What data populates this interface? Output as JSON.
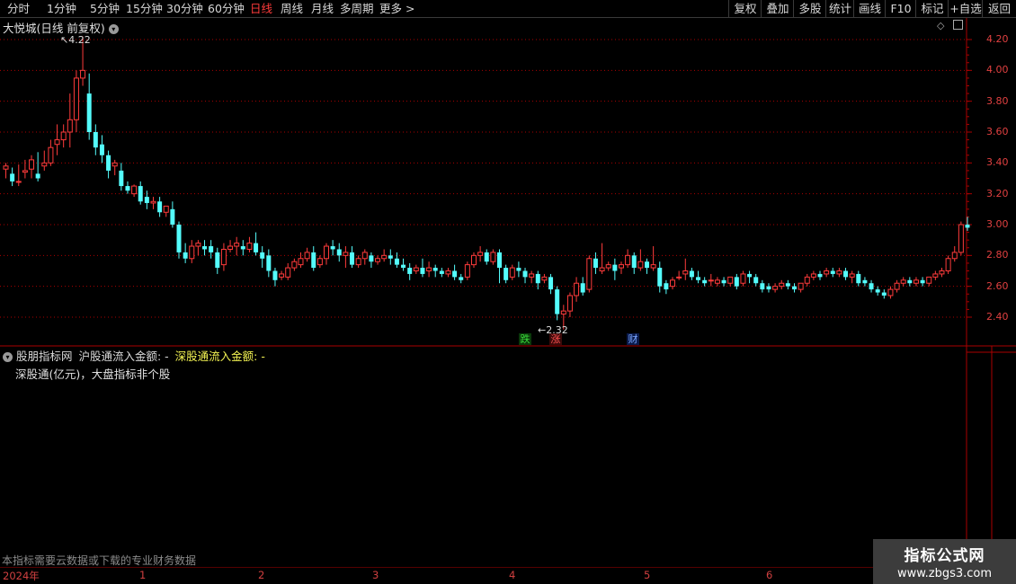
{
  "toolbar": {
    "periods": [
      "分时",
      "1分钟",
      "5分钟",
      "15分钟",
      "30分钟",
      "60分钟",
      "日线",
      "周线",
      "月线",
      "多周期",
      "更多 >"
    ],
    "active_period": "日线",
    "actions": [
      "复权",
      "叠加",
      "多股",
      "统计",
      "画线",
      "F10",
      "标记",
      "+自选",
      "返回"
    ]
  },
  "chart_title": "大悦城(日线 前复权)",
  "price_axis": [
    "4.20",
    "4.00",
    "3.80",
    "3.60",
    "3.40",
    "3.20",
    "3.00",
    "2.80",
    "2.60",
    "2.40"
  ],
  "annotations": {
    "high": "4.22",
    "low": "2.32"
  },
  "event_marks": [
    {
      "text": "跌",
      "color": "#3ad83a"
    },
    {
      "text": "涨",
      "color": "#ff4040"
    },
    {
      "text": "财",
      "color": "#5a8cff"
    }
  ],
  "indicator": {
    "source": "股朋指标网",
    "sh_label": "沪股通流入金额: -",
    "sz_label": "深股通流入金额: -",
    "desc": "深股通(亿元)，大盘指标非个股"
  },
  "note": "本指标需要云数据或下载的专业财务数据",
  "date_axis": [
    "2024年",
    "1",
    "2",
    "3",
    "4",
    "5",
    "6"
  ],
  "watermark": {
    "title": "指标公式网",
    "url": "www.zbgs3.com"
  },
  "colors": {
    "up": "#ff3b3b",
    "down": "#54fcfc",
    "grid": "#aa0000"
  },
  "chart_data": {
    "type": "candlestick",
    "y_axis": [
      2.4,
      4.2
    ],
    "candles": [
      [
        3.36,
        3.4,
        3.38,
        3.3
      ],
      [
        3.33,
        3.37,
        3.28,
        3.25
      ],
      [
        3.28,
        3.39,
        3.28,
        3.25
      ],
      [
        3.34,
        3.42,
        3.35,
        3.3
      ],
      [
        3.36,
        3.45,
        3.42,
        3.3
      ],
      [
        3.33,
        3.47,
        3.3,
        3.28
      ],
      [
        3.38,
        3.48,
        3.4,
        3.35
      ],
      [
        3.4,
        3.55,
        3.5,
        3.38
      ],
      [
        3.52,
        3.65,
        3.55,
        3.45
      ],
      [
        3.55,
        3.65,
        3.6,
        3.5
      ],
      [
        3.6,
        3.85,
        3.68,
        3.5
      ],
      [
        3.68,
        4.0,
        3.95,
        3.6
      ],
      [
        3.95,
        4.22,
        4.0,
        3.9
      ],
      [
        3.85,
        3.98,
        3.6,
        3.55
      ],
      [
        3.6,
        3.65,
        3.5,
        3.45
      ],
      [
        3.52,
        3.58,
        3.45,
        3.4
      ],
      [
        3.45,
        3.48,
        3.35,
        3.3
      ],
      [
        3.38,
        3.42,
        3.4,
        3.32
      ],
      [
        3.35,
        3.4,
        3.25,
        3.22
      ],
      [
        3.25,
        3.28,
        3.22,
        3.2
      ],
      [
        3.2,
        3.26,
        3.25,
        3.18
      ],
      [
        3.25,
        3.28,
        3.15,
        3.13
      ],
      [
        3.18,
        3.22,
        3.14,
        3.1
      ],
      [
        3.14,
        3.18,
        3.15,
        3.1
      ],
      [
        3.15,
        3.18,
        3.08,
        3.05
      ],
      [
        3.08,
        3.12,
        3.12,
        3.05
      ],
      [
        3.1,
        3.15,
        3.0,
        2.98
      ],
      [
        3.0,
        3.02,
        2.82,
        2.78
      ],
      [
        2.82,
        2.88,
        2.78,
        2.75
      ],
      [
        2.78,
        2.9,
        2.86,
        2.75
      ],
      [
        2.86,
        2.9,
        2.88,
        2.8
      ],
      [
        2.86,
        2.9,
        2.84,
        2.8
      ],
      [
        2.86,
        2.9,
        2.82,
        2.78
      ],
      [
        2.82,
        2.85,
        2.72,
        2.68
      ],
      [
        2.74,
        2.88,
        2.84,
        2.7
      ],
      [
        2.84,
        2.9,
        2.86,
        2.82
      ],
      [
        2.86,
        2.92,
        2.88,
        2.8
      ],
      [
        2.86,
        2.9,
        2.84,
        2.8
      ],
      [
        2.84,
        2.92,
        2.88,
        2.82
      ],
      [
        2.88,
        2.95,
        2.82,
        2.8
      ],
      [
        2.82,
        2.86,
        2.78,
        2.72
      ],
      [
        2.8,
        2.84,
        2.7,
        2.66
      ],
      [
        2.7,
        2.72,
        2.64,
        2.6
      ],
      [
        2.66,
        2.7,
        2.68,
        2.64
      ],
      [
        2.66,
        2.75,
        2.72,
        2.64
      ],
      [
        2.72,
        2.78,
        2.76,
        2.7
      ],
      [
        2.74,
        2.82,
        2.78,
        2.72
      ],
      [
        2.78,
        2.85,
        2.82,
        2.76
      ],
      [
        2.82,
        2.86,
        2.72,
        2.7
      ],
      [
        2.74,
        2.8,
        2.78,
        2.72
      ],
      [
        2.78,
        2.88,
        2.86,
        2.74
      ],
      [
        2.86,
        2.9,
        2.84,
        2.8
      ],
      [
        2.84,
        2.88,
        2.8,
        2.76
      ],
      [
        2.8,
        2.86,
        2.82,
        2.72
      ],
      [
        2.82,
        2.86,
        2.74,
        2.72
      ],
      [
        2.74,
        2.8,
        2.78,
        2.72
      ],
      [
        2.78,
        2.84,
        2.82,
        2.74
      ],
      [
        2.8,
        2.82,
        2.76,
        2.72
      ],
      [
        2.76,
        2.8,
        2.78,
        2.74
      ],
      [
        2.78,
        2.84,
        2.8,
        2.76
      ],
      [
        2.8,
        2.84,
        2.78,
        2.74
      ],
      [
        2.78,
        2.82,
        2.74,
        2.72
      ],
      [
        2.74,
        2.78,
        2.72,
        2.7
      ],
      [
        2.72,
        2.75,
        2.68,
        2.64
      ],
      [
        2.7,
        2.74,
        2.72,
        2.68
      ],
      [
        2.72,
        2.78,
        2.68,
        2.66
      ],
      [
        2.7,
        2.76,
        2.72,
        2.66
      ],
      [
        2.72,
        2.74,
        2.7,
        2.66
      ],
      [
        2.7,
        2.72,
        2.68,
        2.66
      ],
      [
        2.68,
        2.72,
        2.7,
        2.66
      ],
      [
        2.7,
        2.74,
        2.66,
        2.64
      ],
      [
        2.66,
        2.68,
        2.64,
        2.62
      ],
      [
        2.66,
        2.76,
        2.74,
        2.64
      ],
      [
        2.74,
        2.82,
        2.8,
        2.72
      ],
      [
        2.8,
        2.86,
        2.82,
        2.76
      ],
      [
        2.82,
        2.84,
        2.76,
        2.74
      ],
      [
        2.76,
        2.84,
        2.82,
        2.74
      ],
      [
        2.82,
        2.84,
        2.72,
        2.62
      ],
      [
        2.72,
        2.74,
        2.64,
        2.62
      ],
      [
        2.66,
        2.74,
        2.72,
        2.64
      ],
      [
        2.72,
        2.76,
        2.7,
        2.66
      ],
      [
        2.7,
        2.72,
        2.66,
        2.62
      ],
      [
        2.66,
        2.7,
        2.68,
        2.62
      ],
      [
        2.68,
        2.7,
        2.62,
        2.58
      ],
      [
        2.64,
        2.68,
        2.66,
        2.62
      ],
      [
        2.66,
        2.68,
        2.58,
        2.55
      ],
      [
        2.58,
        2.6,
        2.42,
        2.38
      ],
      [
        2.42,
        2.48,
        2.44,
        2.32
      ],
      [
        2.44,
        2.56,
        2.54,
        2.4
      ],
      [
        2.54,
        2.66,
        2.62,
        2.5
      ],
      [
        2.62,
        2.66,
        2.56,
        2.54
      ],
      [
        2.58,
        2.8,
        2.78,
        2.56
      ],
      [
        2.78,
        2.82,
        2.72,
        2.68
      ],
      [
        2.7,
        2.88,
        2.72,
        2.68
      ],
      [
        2.72,
        2.76,
        2.74,
        2.7
      ],
      [
        2.74,
        2.78,
        2.7,
        2.64
      ],
      [
        2.72,
        2.76,
        2.74,
        2.68
      ],
      [
        2.74,
        2.84,
        2.8,
        2.72
      ],
      [
        2.8,
        2.82,
        2.72,
        2.68
      ],
      [
        2.72,
        2.84,
        2.76,
        2.7
      ],
      [
        2.76,
        2.78,
        2.72,
        2.68
      ],
      [
        2.72,
        2.86,
        2.74,
        2.7
      ],
      [
        2.72,
        2.76,
        2.6,
        2.56
      ],
      [
        2.62,
        2.64,
        2.58,
        2.55
      ],
      [
        2.6,
        2.66,
        2.64,
        2.58
      ],
      [
        2.66,
        2.7,
        2.66,
        2.64
      ],
      [
        2.68,
        2.78,
        2.7,
        2.64
      ],
      [
        2.7,
        2.72,
        2.66,
        2.64
      ],
      [
        2.66,
        2.7,
        2.64,
        2.62
      ],
      [
        2.64,
        2.66,
        2.62,
        2.6
      ],
      [
        2.64,
        2.68,
        2.64,
        2.6
      ],
      [
        2.62,
        2.66,
        2.64,
        2.6
      ],
      [
        2.64,
        2.66,
        2.62,
        2.6
      ],
      [
        2.62,
        2.66,
        2.66,
        2.6
      ],
      [
        2.66,
        2.68,
        2.6,
        2.58
      ],
      [
        2.62,
        2.7,
        2.68,
        2.6
      ],
      [
        2.68,
        2.7,
        2.66,
        2.62
      ],
      [
        2.66,
        2.68,
        2.62,
        2.6
      ],
      [
        2.62,
        2.64,
        2.58,
        2.56
      ],
      [
        2.6,
        2.62,
        2.58,
        2.56
      ],
      [
        2.58,
        2.62,
        2.6,
        2.56
      ],
      [
        2.6,
        2.64,
        2.62,
        2.58
      ],
      [
        2.62,
        2.64,
        2.6,
        2.58
      ],
      [
        2.6,
        2.62,
        2.58,
        2.56
      ],
      [
        2.58,
        2.62,
        2.62,
        2.56
      ],
      [
        2.62,
        2.68,
        2.66,
        2.6
      ],
      [
        2.66,
        2.7,
        2.68,
        2.64
      ],
      [
        2.68,
        2.7,
        2.66,
        2.64
      ],
      [
        2.68,
        2.72,
        2.7,
        2.66
      ],
      [
        2.7,
        2.72,
        2.68,
        2.66
      ],
      [
        2.68,
        2.72,
        2.7,
        2.66
      ],
      [
        2.7,
        2.72,
        2.66,
        2.64
      ],
      [
        2.66,
        2.7,
        2.68,
        2.62
      ],
      [
        2.68,
        2.7,
        2.62,
        2.6
      ],
      [
        2.64,
        2.66,
        2.62,
        2.6
      ],
      [
        2.62,
        2.64,
        2.58,
        2.56
      ],
      [
        2.58,
        2.6,
        2.56,
        2.54
      ],
      [
        2.56,
        2.58,
        2.54,
        2.52
      ],
      [
        2.54,
        2.6,
        2.58,
        2.52
      ],
      [
        2.58,
        2.64,
        2.62,
        2.56
      ],
      [
        2.62,
        2.66,
        2.64,
        2.6
      ],
      [
        2.64,
        2.66,
        2.62,
        2.6
      ],
      [
        2.62,
        2.66,
        2.64,
        2.6
      ],
      [
        2.64,
        2.66,
        2.62,
        2.6
      ],
      [
        2.62,
        2.66,
        2.66,
        2.6
      ],
      [
        2.66,
        2.7,
        2.68,
        2.64
      ],
      [
        2.68,
        2.72,
        2.7,
        2.66
      ],
      [
        2.7,
        2.8,
        2.78,
        2.68
      ],
      [
        2.78,
        2.86,
        2.82,
        2.76
      ],
      [
        2.82,
        3.02,
        3.0,
        2.8
      ],
      [
        3.0,
        3.05,
        2.98,
        2.96
      ]
    ]
  }
}
